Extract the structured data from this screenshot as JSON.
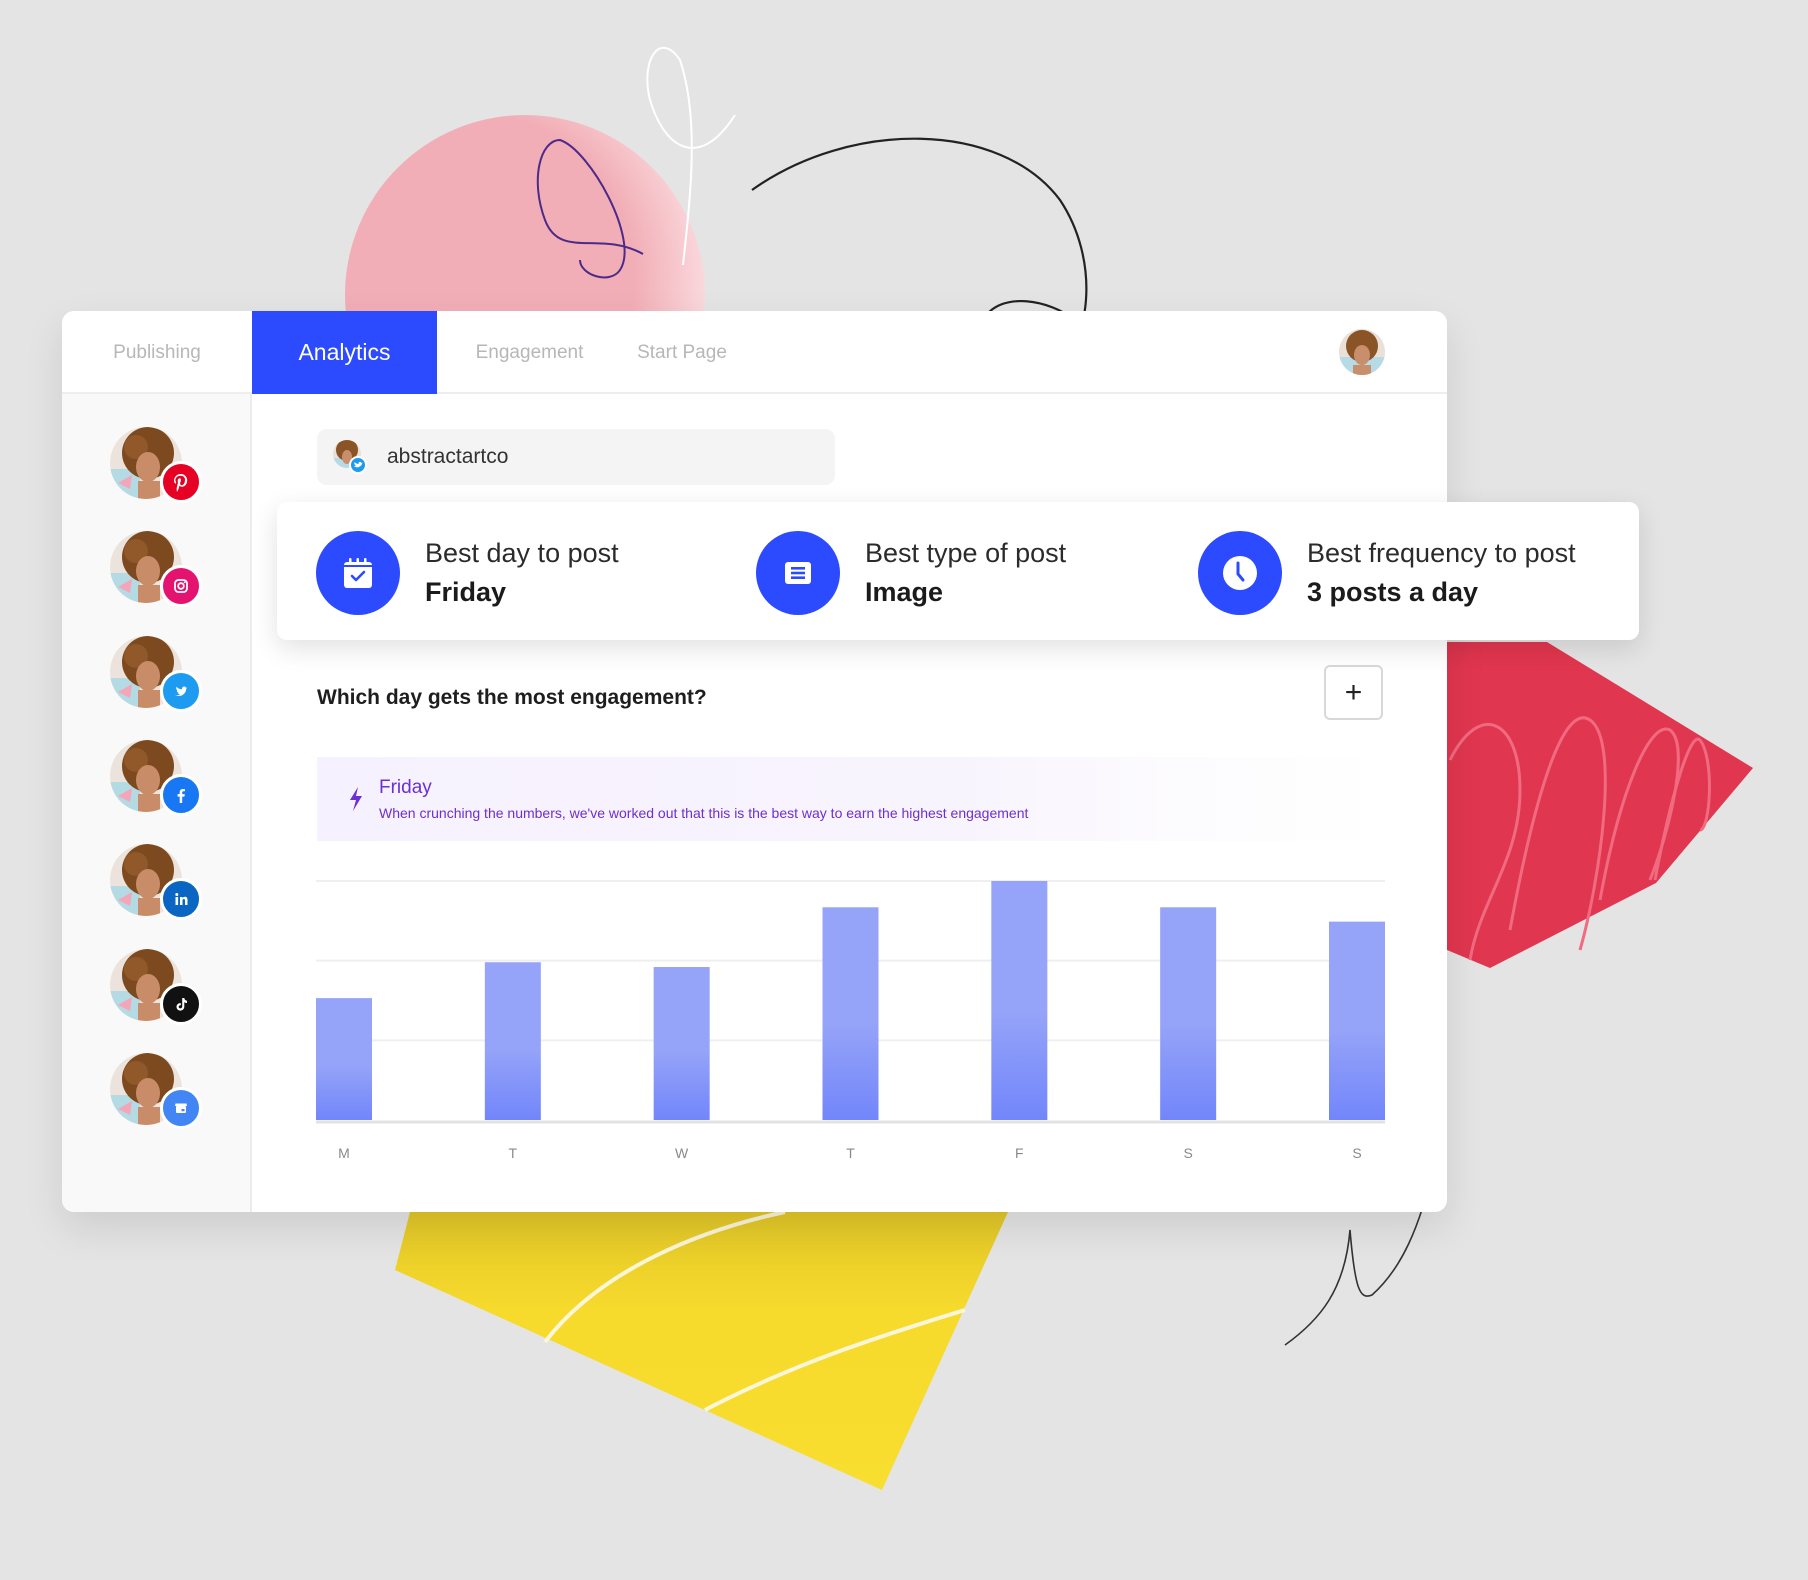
{
  "colors": {
    "accent": "#2c4bff",
    "bar_top": "#95a3f8",
    "bar_bottom": "#7286fa",
    "insight_text": "#6d2fd1",
    "background": "#e4e4e4",
    "deco_pink": "#f2aeb6",
    "deco_red": "#e1364f",
    "deco_yellow": "#f6da2c"
  },
  "header": {
    "tabs": [
      {
        "label": "Publishing",
        "active": false
      },
      {
        "label": "Analytics",
        "active": true
      },
      {
        "label": "Engagement",
        "active": false
      },
      {
        "label": "Start Page",
        "active": false
      }
    ],
    "avatar_icon": "user-avatar"
  },
  "sidebar": {
    "items": [
      {
        "network": "Pinterest",
        "icon": "pinterest-icon",
        "color": "#e60023"
      },
      {
        "network": "Instagram",
        "icon": "instagram-icon",
        "color": "#e4136f"
      },
      {
        "network": "Twitter",
        "icon": "twitter-icon",
        "color": "#1d9bf0"
      },
      {
        "network": "Facebook",
        "icon": "facebook-icon",
        "color": "#1877f2"
      },
      {
        "network": "LinkedIn",
        "icon": "linkedin-icon",
        "color": "#0a66c2"
      },
      {
        "network": "TikTok",
        "icon": "tiktok-icon",
        "color": "#111111"
      },
      {
        "network": "Google Business",
        "icon": "google-business-icon",
        "color": "#4285f4"
      }
    ]
  },
  "account": {
    "name": "abstractartco",
    "network_icon": "twitter-icon"
  },
  "info_card": {
    "items": [
      {
        "label": "Best day to post",
        "value": "Friday",
        "icon": "calendar-check-icon"
      },
      {
        "label": "Best type of post",
        "value": "Image",
        "icon": "document-icon"
      },
      {
        "label": "Best frequency to post",
        "value": "3 posts a day",
        "icon": "clock-icon"
      }
    ]
  },
  "section": {
    "title": "Which day gets the most engagement?",
    "add_button_label": "+"
  },
  "insight": {
    "icon": "lightning-icon",
    "title": "Friday",
    "body": "When crunching the numbers, we've worked out that this is the best way to earn the highest engagement"
  },
  "chart_data": {
    "type": "bar",
    "title": "Which day gets the most engagement?",
    "xlabel": "",
    "ylabel": "",
    "categories": [
      "M",
      "T",
      "W",
      "T",
      "F",
      "S",
      "S"
    ],
    "values": [
      51,
      66,
      64,
      89,
      100,
      89,
      83
    ],
    "ylim": [
      0,
      100
    ],
    "grid": true,
    "gridlines": [
      33.3,
      66.7,
      100
    ],
    "legend": "none",
    "note": "values relative to Friday max = 100 (no y-axis tick labels shown)"
  }
}
